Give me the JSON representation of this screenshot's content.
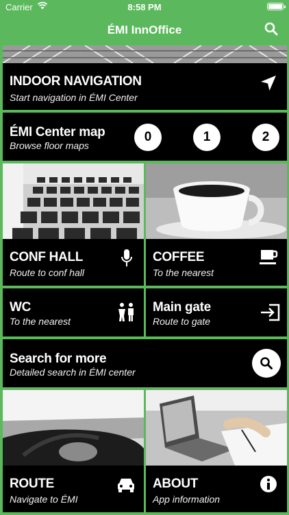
{
  "status_bar": {
    "carrier": "Carrier",
    "time": "8:58 PM"
  },
  "header": {
    "title": "ÉMI InnOffice"
  },
  "tiles": {
    "indoor": {
      "title": "INDOOR NAVIGATION",
      "subtitle": "Start navigation in ÉMI Center"
    },
    "map": {
      "title": "ÉMI Center map",
      "subtitle": "Browse floor maps",
      "floors": [
        "0",
        "1",
        "2"
      ]
    },
    "conf": {
      "title": "CONF HALL",
      "subtitle": "Route to conf hall"
    },
    "coffee": {
      "title": "COFFEE",
      "subtitle": "To the nearest"
    },
    "wc": {
      "title": "WC",
      "subtitle": "To the nearest"
    },
    "gate": {
      "title": "Main gate",
      "subtitle": "Route to gate"
    },
    "search": {
      "title": "Search for more",
      "subtitle": "Detailed search in ÉMI center"
    },
    "route": {
      "title": "ROUTE",
      "subtitle": "Navigate to ÉMI"
    },
    "about": {
      "title": "ABOUT",
      "subtitle": "App information"
    }
  },
  "colors": {
    "accent": "#5cb85c",
    "tile": "#000000"
  }
}
